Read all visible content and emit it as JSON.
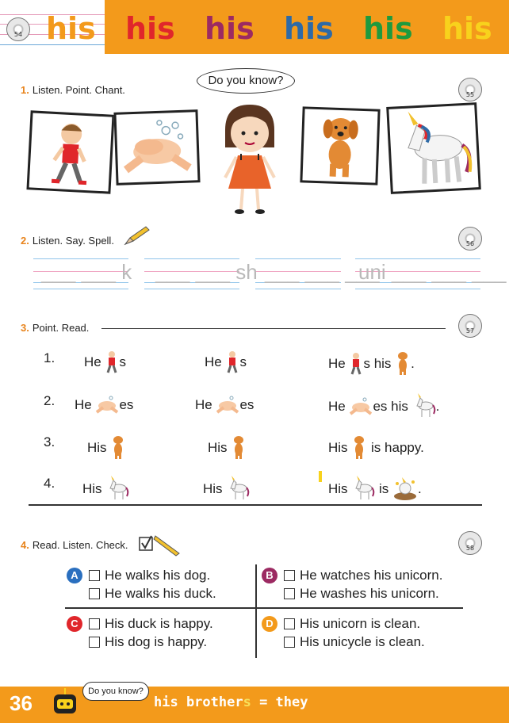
{
  "header": {
    "cd_track": "54",
    "words": [
      {
        "text": "his",
        "color": "#ffffff"
      },
      {
        "text": "his",
        "color": "#e0262b"
      },
      {
        "text": "his",
        "color": "#9c2a62"
      },
      {
        "text": "his",
        "color": "#2e6aa6"
      },
      {
        "text": "his",
        "color": "#1e9a3e"
      },
      {
        "text": "his",
        "color": "#f8d21c"
      }
    ],
    "band_color": "#f39a1b"
  },
  "section1": {
    "number": "1.",
    "title": "Listen. Point. Chant.",
    "cd_track": "55",
    "bubble": "Do you know?",
    "pictures": [
      "boy-walking-picture",
      "hands-washing-picture",
      "girl-picture",
      "dog-picture",
      "unicorn-picture"
    ]
  },
  "section2": {
    "number": "2.",
    "title": "Listen. Say. Spell.",
    "cd_track": "56",
    "traces": [
      "___ ___ k",
      "___ ___ sh",
      "___ ___ ___",
      "uni ___ ___ ___"
    ]
  },
  "section3": {
    "number": "3.",
    "title": "Point. Read.",
    "cd_track": "57",
    "rows": [
      {
        "num": "1.",
        "a": [
          "He",
          "s"
        ],
        "b": [
          "He",
          "s"
        ],
        "c": [
          "He",
          "s his",
          "."
        ]
      },
      {
        "num": "2.",
        "a": [
          "He",
          "es"
        ],
        "b": [
          "He",
          "es"
        ],
        "c": [
          "He",
          "es his",
          "."
        ]
      },
      {
        "num": "3.",
        "a": [
          "His"
        ],
        "b": [
          "His"
        ],
        "c": [
          "His",
          "is happy."
        ]
      },
      {
        "num": "4.",
        "a": [
          "His"
        ],
        "b": [
          "His"
        ],
        "c": [
          "His",
          "is",
          "."
        ]
      }
    ]
  },
  "section4": {
    "number": "4.",
    "title": "Read. Listen. Check.",
    "cd_track": "58",
    "groups": [
      {
        "badge": "A",
        "color": "#2a6fbf",
        "lines": [
          "He walks his dog.",
          "He walks his duck."
        ]
      },
      {
        "badge": "B",
        "color": "#9c2a62",
        "lines": [
          "He watches his unicorn.",
          "He washes his unicorn."
        ]
      },
      {
        "badge": "C",
        "color": "#e0262b",
        "lines": [
          "His duck is happy.",
          "His dog is happy."
        ]
      },
      {
        "badge": "D",
        "color": "#f39a1b",
        "lines": [
          "His unicorn is clean.",
          "His unicycle is clean."
        ]
      }
    ]
  },
  "footer": {
    "page_number": "36",
    "bubble": "Do you know?",
    "text_before": "his brother",
    "text_highlight": "s",
    "text_after": " = they"
  }
}
